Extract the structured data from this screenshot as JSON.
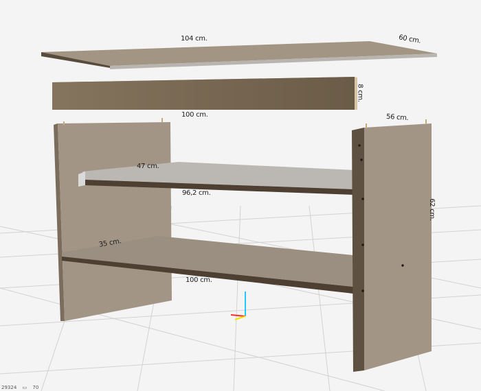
{
  "colors": {
    "background": "#f4f4f4",
    "grid": "#d0d0d0",
    "wood_face": "#a29585",
    "wood_face_dark": "#8f8474",
    "wood_edge": "#5a4c3d",
    "shelf_top": "#bdbab5",
    "axis_x": "#ff2a2a",
    "axis_y": "#f2e200",
    "axis_z": "#20c8ff"
  },
  "dimensions": {
    "top_length": "104 cm.",
    "top_depth": "60 cm.",
    "apron_height": "8 cm.",
    "apron_length": "100 cm.",
    "side_depth": "56 cm.",
    "side_height": "62 cm.",
    "upper_shelf_depth": "47 cm.",
    "upper_shelf_length": "96,2 cm.",
    "lower_shelf_depth": "35 cm.",
    "lower_shelf_length": "100 cm."
  },
  "status": {
    "polygons": "29324",
    "objects": "70",
    "objects_icon": "layers-icon"
  }
}
